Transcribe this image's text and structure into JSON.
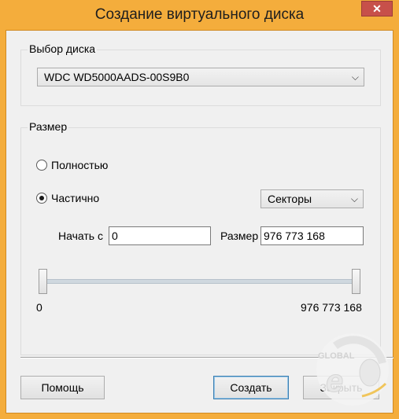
{
  "window": {
    "title": "Создание виртуального диска"
  },
  "disk_group": {
    "legend": "Выбор диска",
    "disk_combo": {
      "value": "WDC WD5000AADS-00S9B0"
    }
  },
  "size_group": {
    "legend": "Размер",
    "radio_full": {
      "label": "Полностью",
      "checked": false
    },
    "radio_partial": {
      "label": "Частично",
      "checked": true
    },
    "unit_combo": {
      "value": "Секторы"
    },
    "start": {
      "label": "Начать с",
      "value": "0"
    },
    "size": {
      "label": "Размер",
      "value": "976 773 168"
    },
    "range": {
      "min_label": "0",
      "max_label": "976 773 168",
      "start_fraction": 0.0,
      "end_fraction": 1.0
    }
  },
  "buttons": {
    "help": "Помощь",
    "create": "Создать",
    "close": "Закрыть"
  },
  "watermark": {
    "text": "GLOBAL"
  },
  "colors": {
    "frame": "#f4ad3c",
    "close_button": "#c7504a",
    "dialog_bg": "#f0f0f0"
  }
}
